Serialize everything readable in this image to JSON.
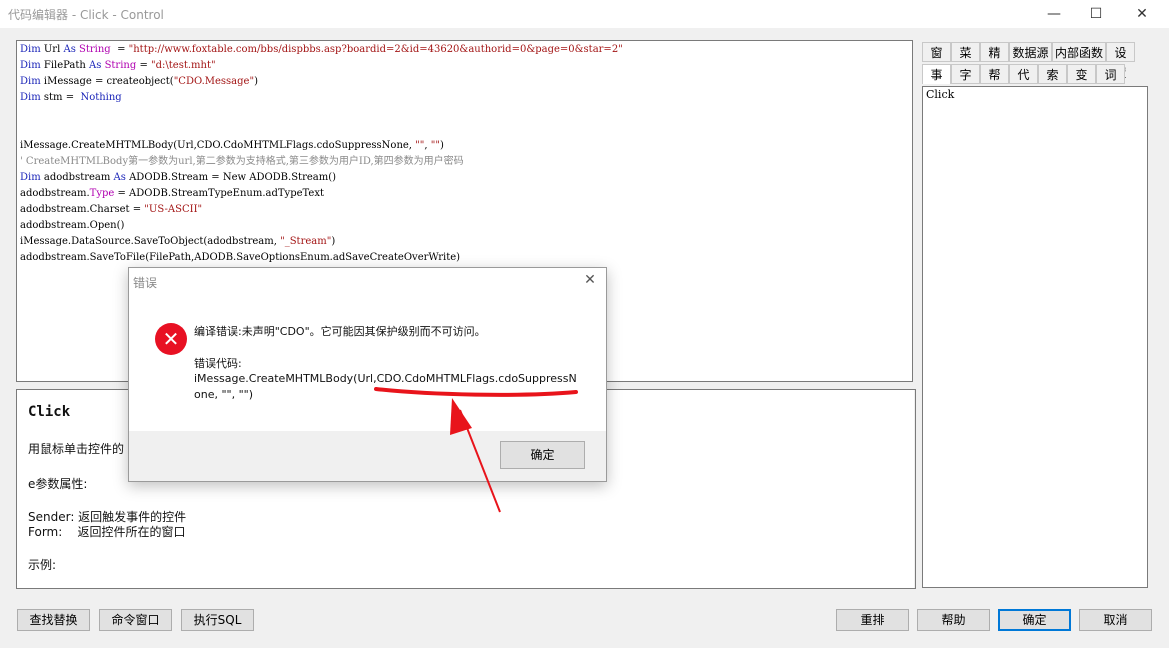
{
  "window": {
    "title": "代码编辑器 - Click - Control",
    "minimize": "—",
    "maximize": "☐",
    "close": "✕"
  },
  "code_lines": [
    [
      {
        "t": "Dim",
        "c": "kw"
      },
      {
        "t": " Url "
      },
      {
        "t": "As",
        "c": "kw"
      },
      {
        "t": " "
      },
      {
        "t": "String",
        "c": "ty"
      },
      {
        "t": "  = "
      },
      {
        "t": "\"http://www.foxtable.com/bbs/dispbbs.asp?boardid=2&id=43620&authorid=0&page=0&star=2\"",
        "c": "str"
      }
    ],
    [
      {
        "t": "Dim",
        "c": "kw"
      },
      {
        "t": " FilePath "
      },
      {
        "t": "As",
        "c": "kw"
      },
      {
        "t": " "
      },
      {
        "t": "String",
        "c": "ty"
      },
      {
        "t": " = "
      },
      {
        "t": "\"d:\\test.mht\"",
        "c": "str"
      }
    ],
    [
      {
        "t": "Dim",
        "c": "kw"
      },
      {
        "t": " iMessage = createobject("
      },
      {
        "t": "\"CDO.Message\"",
        "c": "str"
      },
      {
        "t": ")"
      }
    ],
    [
      {
        "t": "Dim",
        "c": "kw"
      },
      {
        "t": " stm =  "
      },
      {
        "t": "Nothing",
        "c": "kw"
      }
    ],
    [],
    [],
    [
      {
        "t": "iMessage.CreateMHTMLBody(Url,CDO.CdoMHTMLFlags.cdoSuppressNone, "
      },
      {
        "t": "\"\"",
        "c": "str"
      },
      {
        "t": ", "
      },
      {
        "t": "\"\"",
        "c": "str"
      },
      {
        "t": ")"
      }
    ],
    [
      {
        "t": "' CreateMHTMLBody第一参数为url,第二参数为支持格式,第三参数为用户ID,第四参数为用户密码",
        "c": "cm"
      }
    ],
    [
      {
        "t": "Dim",
        "c": "kw"
      },
      {
        "t": " adodbstream "
      },
      {
        "t": "As",
        "c": "kw"
      },
      {
        "t": " ADODB.Stream = New ADODB.Stream()"
      }
    ],
    [
      {
        "t": "adodbstream."
      },
      {
        "t": "Type",
        "c": "ty"
      },
      {
        "t": " = ADODB.StreamTypeEnum.adTypeText"
      }
    ],
    [
      {
        "t": "adodbstream.Charset = "
      },
      {
        "t": "\"US-ASCII\"",
        "c": "str"
      }
    ],
    [
      {
        "t": "adodbstream.Open()"
      }
    ],
    [
      {
        "t": "iMessage.DataSource.SaveToObject(adodbstream, "
      },
      {
        "t": "\"_Stream\"",
        "c": "str"
      },
      {
        "t": ")"
      }
    ],
    [
      {
        "t": "adodbstream.SaveToFile(FilePath,ADODB.SaveOptionsEnum.adSaveCreateOverWrite)"
      }
    ]
  ],
  "help": {
    "heading": "Click",
    "desc": "用鼠标单击控件的",
    "params_title": "e参数属性:",
    "sender": "Sender: 返回触发事件的控件",
    "form": "Form:    返回控件所在的窗口",
    "example": "示例:"
  },
  "tabs_row1": [
    "窗口",
    "菜单",
    "精灵",
    "数据源",
    "内部函数",
    "设置"
  ],
  "tabs_row2": [
    "事件",
    "字段",
    "帮助",
    "代码",
    "索引",
    "变量",
    "词汇"
  ],
  "event_list": [
    "Click"
  ],
  "bottom_buttons": {
    "find_replace": "查找替换",
    "command_window": "命令窗口",
    "exec_sql": "执行SQL",
    "rearrange": "重排",
    "help": "帮助",
    "ok": "确定",
    "cancel": "取消"
  },
  "dialog": {
    "title": "错误",
    "message": "编译错误:未声明\"CDO\"。它可能因其保护级别而不可访问。",
    "code_label": "错误代码:",
    "code_line1": "iMessage.CreateMHTMLBody(Url,CDO.CdoMHTMLFlags.cdoSuppressN",
    "code_line2": "one, \"\", \"\")",
    "ok": "确定",
    "close": "✕",
    "icon": "error-icon"
  },
  "colors": {
    "keyword": "#1a24b8",
    "string": "#a31515",
    "comment": "#8a8a8a",
    "annotation": "#e8141b",
    "ok_border": "#0078d7"
  }
}
